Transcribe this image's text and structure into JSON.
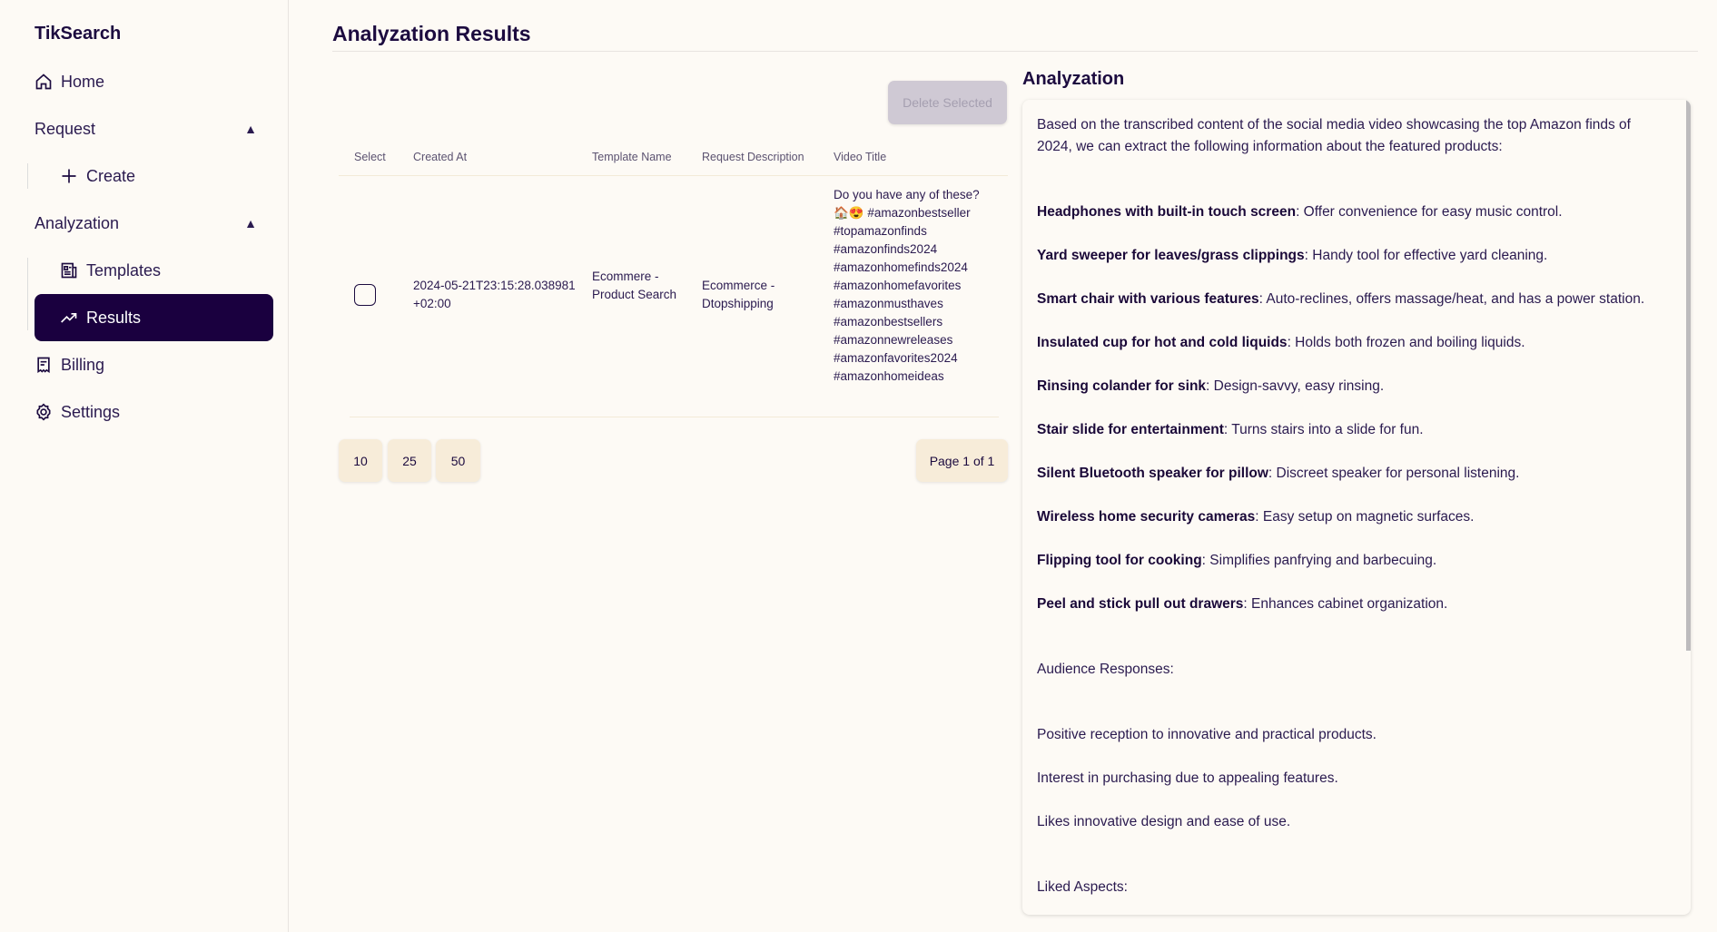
{
  "sidebar": {
    "brand": "TikSearch",
    "items": {
      "home": "Home",
      "request": "Request",
      "create": "Create",
      "analyzation": "Analyzation",
      "templates": "Templates",
      "results": "Results",
      "billing": "Billing",
      "settings": "Settings"
    }
  },
  "main": {
    "title": "Analyzation Results",
    "delete_label": "Delete Selected",
    "columns": [
      "Select",
      "Created At",
      "Template Name",
      "Request Description",
      "Video Title"
    ],
    "row": {
      "created_at": "2024-05-21T23:15:28.038981+02:00",
      "template_name": "Ecommere - Product Search",
      "request_description": "Ecommerce - Dtopshipping",
      "video_title": "Do you have any of these? 🏠😍 #amazonbestseller #topamazonfinds #amazonfinds2024 #amazonhomefinds2024 #amazonhomefavorites #amazonmusthaves #amazonbestsellers #amazonnewreleases #amazonfavorites2024 #amazonhomeideas",
      "selected": false
    },
    "page_sizes": [
      "10",
      "25",
      "50"
    ],
    "page_info": "Page 1 of 1"
  },
  "analysis": {
    "title": "Analyzation",
    "intro": "Based on the transcribed content of the social media video showcasing the top Amazon finds of 2024, we can extract the following information about the featured products:",
    "products": [
      {
        "name": "Headphones with built-in touch screen",
        "desc": ": Offer convenience for easy music control."
      },
      {
        "name": "Yard sweeper for leaves/grass clippings",
        "desc": ": Handy tool for effective yard cleaning."
      },
      {
        "name": "Smart chair with various features",
        "desc": ": Auto-reclines, offers massage/heat, and has a power station."
      },
      {
        "name": "Insulated cup for hot and cold liquids",
        "desc": ": Holds both frozen and boiling liquids."
      },
      {
        "name": "Rinsing colander for sink",
        "desc": ": Design-savvy, easy rinsing."
      },
      {
        "name": "Stair slide for entertainment",
        "desc": ": Turns stairs into a slide for fun."
      },
      {
        "name": "Silent Bluetooth speaker for pillow",
        "desc": ": Discreet speaker for personal listening."
      },
      {
        "name": "Wireless home security cameras",
        "desc": ": Easy setup on magnetic surfaces."
      },
      {
        "name": "Flipping tool for cooking",
        "desc": ": Simplifies panfrying and barbecuing."
      },
      {
        "name": "Peel and stick pull out drawers",
        "desc": ": Enhances cabinet organization."
      }
    ],
    "audience_heading": "Audience Responses:",
    "audience": [
      "Positive reception to innovative and practical products.",
      "Interest in purchasing due to appealing features.",
      "Likes innovative design and ease of use."
    ],
    "liked_heading": "Liked Aspects:"
  }
}
